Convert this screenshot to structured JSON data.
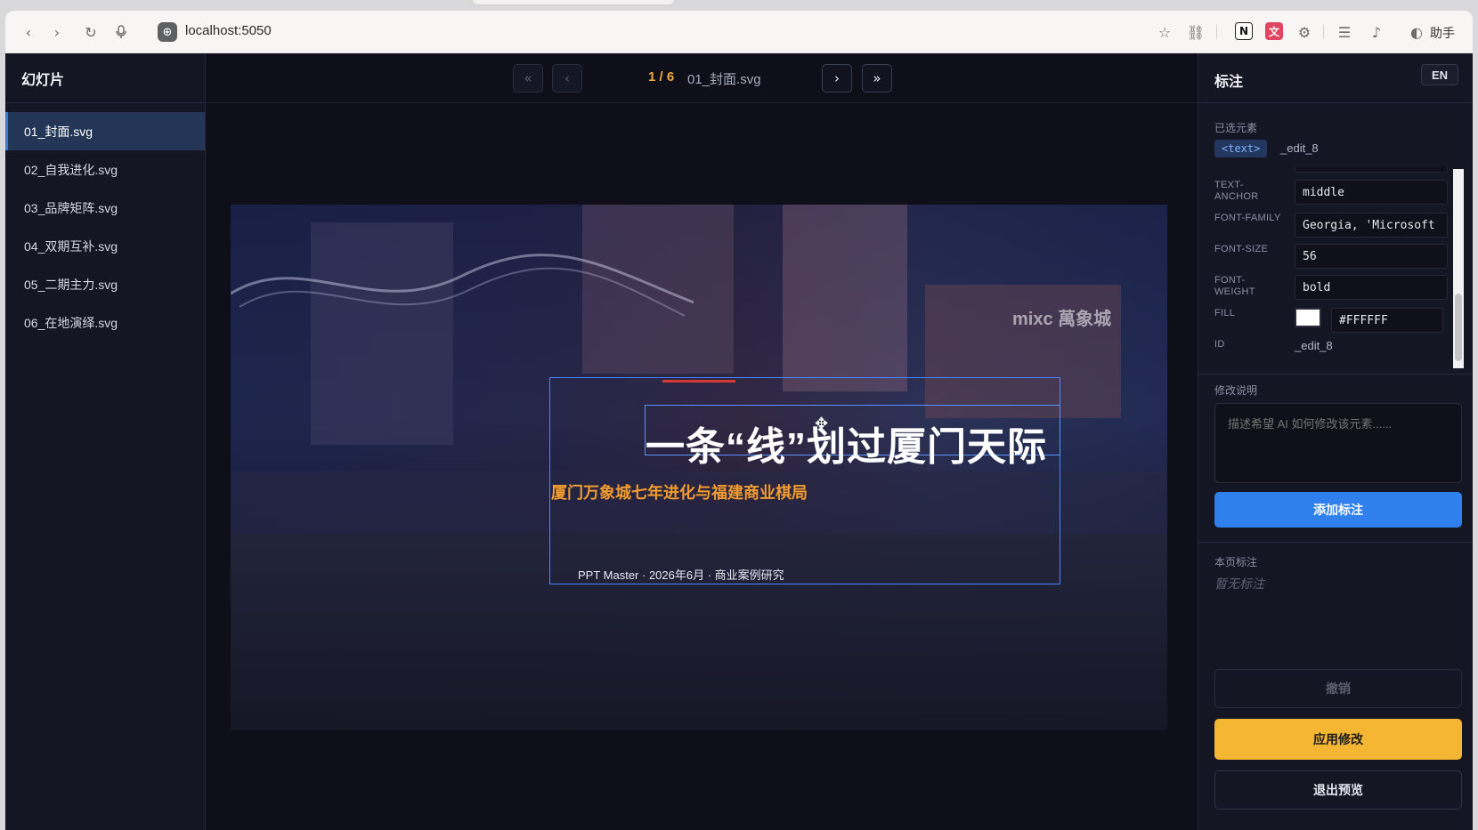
{
  "browser": {
    "url": "localhost:5050",
    "assistant_label": "助手"
  },
  "sidebar": {
    "title": "幻灯片",
    "items": [
      {
        "label": "01_封面.svg",
        "active": true
      },
      {
        "label": "02_自我进化.svg"
      },
      {
        "label": "03_品牌矩阵.svg"
      },
      {
        "label": "04_双期互补.svg"
      },
      {
        "label": "05_二期主力.svg"
      },
      {
        "label": "06_在地演绎.svg"
      }
    ]
  },
  "pager": {
    "first": "«",
    "prev": "‹",
    "counter": "1 / 6",
    "file": "01_封面.svg",
    "next": "›",
    "last": "»"
  },
  "slide": {
    "title": "一条“线”划过厦门天际",
    "subtitle": "厦门万象城七年进化与福建商业棋局",
    "footer": "PPT Master · 2026年6月 · 商业案例研究",
    "sign_text": "mixc 萬象城"
  },
  "panel": {
    "title": "标注",
    "lang_button": "EN",
    "selected_label": "已选元素",
    "selected_tag": "<text>",
    "selected_id": "_edit_8",
    "props": [
      {
        "key": "TEXT-ANCHOR",
        "value": "middle"
      },
      {
        "key": "FONT-FAMILY",
        "value": "Georgia, 'Microsoft"
      },
      {
        "key": "FONT-SIZE",
        "value": "56"
      },
      {
        "key": "FONT-WEIGHT",
        "value": "bold"
      },
      {
        "key": "FILL",
        "value": "#FFFFFF"
      },
      {
        "key": "ID",
        "value": "_edit_8"
      }
    ],
    "note_label": "修改说明",
    "note_placeholder": "描述希望 AI 如何修改该元素......",
    "add_button": "添加标注",
    "page_notes_label": "本页标注",
    "empty_notes": "暂无标注",
    "undo_button": "撤销",
    "apply_button": "应用修改",
    "exit_button": "退出预览"
  },
  "colors": {
    "accent_blue": "#2f80ed",
    "accent_orange": "#f2a93b",
    "apply_yellow": "#f4b633",
    "title_white": "#ffffff",
    "subtitle_orange": "#f29b2e"
  }
}
